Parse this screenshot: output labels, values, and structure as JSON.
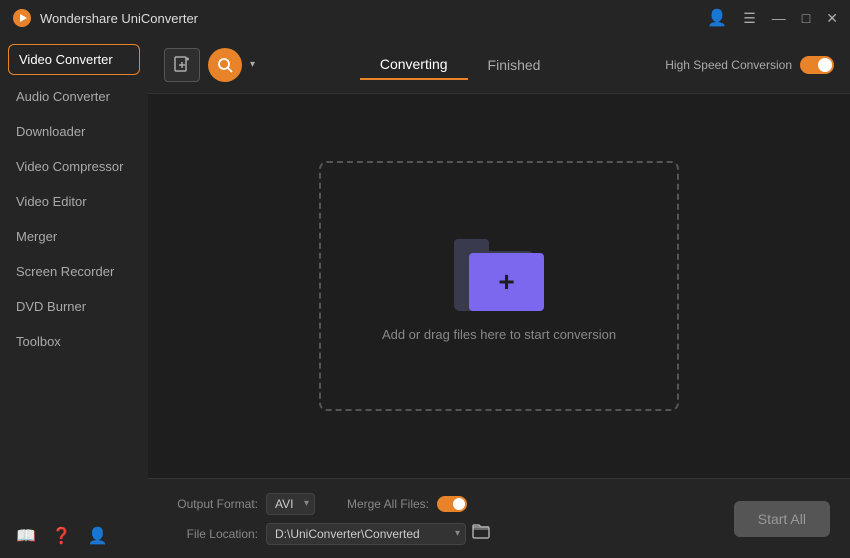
{
  "app": {
    "title": "Wondershare UniConverter",
    "icon": "🎬"
  },
  "titlebar": {
    "controls": [
      "⊞",
      "—",
      "□",
      "✕"
    ]
  },
  "sidebar": {
    "items": [
      {
        "id": "video-converter",
        "label": "Video Converter",
        "active": true
      },
      {
        "id": "audio-converter",
        "label": "Audio Converter",
        "active": false
      },
      {
        "id": "downloader",
        "label": "Downloader",
        "active": false
      },
      {
        "id": "video-compressor",
        "label": "Video Compressor",
        "active": false
      },
      {
        "id": "video-editor",
        "label": "Video Editor",
        "active": false
      },
      {
        "id": "merger",
        "label": "Merger",
        "active": false
      },
      {
        "id": "screen-recorder",
        "label": "Screen Recorder",
        "active": false
      },
      {
        "id": "dvd-burner",
        "label": "DVD Burner",
        "active": false
      },
      {
        "id": "toolbox",
        "label": "Toolbox",
        "active": false
      }
    ]
  },
  "toolbar": {
    "add_button_label": "+",
    "tabs": [
      {
        "id": "converting",
        "label": "Converting",
        "active": true
      },
      {
        "id": "finished",
        "label": "Finished",
        "active": false
      }
    ],
    "high_speed_label": "High Speed Conversion",
    "toggle_on": true
  },
  "dropzone": {
    "text": "Add or drag files here to start conversion"
  },
  "footer": {
    "output_format_label": "Output Format:",
    "output_format_value": "AVI",
    "merge_files_label": "Merge All Files:",
    "file_location_label": "File Location:",
    "file_location_value": "D:\\UniConverter\\Converted",
    "start_all_label": "Start All"
  }
}
